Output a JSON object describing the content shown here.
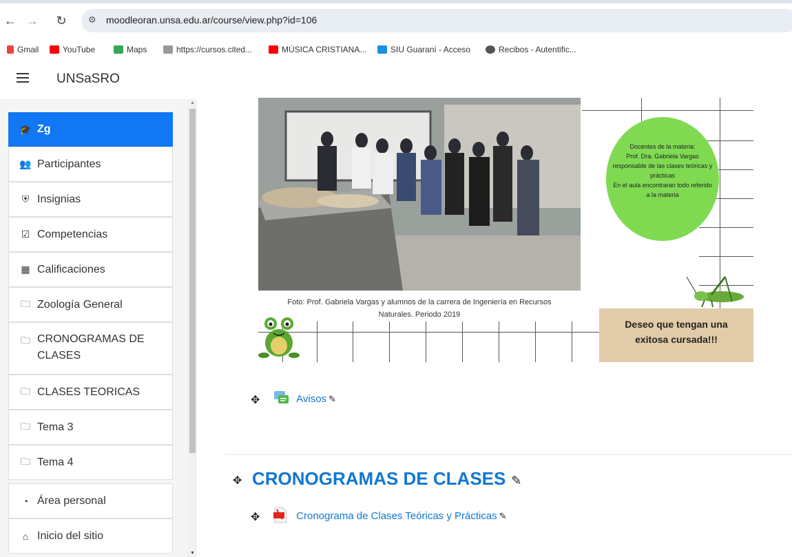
{
  "browser": {
    "url": "moodleoran.unsa.edu.ar/course/view.php?id=106",
    "bookmarks": [
      {
        "label": "Gmail",
        "color": "#e8453c"
      },
      {
        "label": "YouTube",
        "color": "#ff0000"
      },
      {
        "label": "Maps",
        "color": "#34a853"
      },
      {
        "label": "https://cursos.cited...",
        "color": "#888888"
      },
      {
        "label": "MÚSICA CRISTIANA...",
        "color": "#ff0000"
      },
      {
        "label": "SIU Guaraní - Acceso",
        "color": "#1a8fe3"
      },
      {
        "label": "Recibos - Autentific...",
        "color": "#555555"
      }
    ]
  },
  "navbar": {
    "brand": "UNSaSRO"
  },
  "drawer": {
    "items": [
      {
        "label": "Zg",
        "icon": "graduation-cap-icon",
        "active": true
      },
      {
        "label": "Participantes",
        "icon": "users-icon"
      },
      {
        "label": "Insignias",
        "icon": "shield-icon"
      },
      {
        "label": "Competencias",
        "icon": "check-square-icon"
      },
      {
        "label": "Calificaciones",
        "icon": "table-icon"
      },
      {
        "label": "Zoología General",
        "icon": "folder-icon"
      },
      {
        "label": "CRONOGRAMAS DE CLASES",
        "icon": "folder-icon"
      },
      {
        "label": "CLASES TEORICAS",
        "icon": "folder-icon"
      },
      {
        "label": "Tema 3",
        "icon": "folder-icon"
      },
      {
        "label": "Tema 4",
        "icon": "folder-icon"
      },
      {
        "label": "Área personal",
        "icon": "dashboard-icon"
      },
      {
        "label": "Inicio del sitio",
        "icon": "home-icon"
      }
    ]
  },
  "banner": {
    "teachers_text": [
      "Docentes de la materia:",
      "Prof. Dra. Gabriela Vargas",
      "responsable de las clases teóricas y",
      "prácticas",
      "En el aula encontraran todo referido",
      "a la materia"
    ],
    "caption": [
      "Foto: Prof. Gabriela Vargas  y  alumnos de la carrera de  Ingeniería en Recursos",
      "Naturales. Periodo 2019"
    ],
    "wish": [
      "Deseo que tengan una",
      "exitosa cursada!!!"
    ]
  },
  "main": {
    "avisos_label": "Avisos",
    "section_title": "CRONOGRAMAS DE CLASES",
    "cronograma_label": "Cronograma de Clases Teóricas y Prácticas"
  }
}
